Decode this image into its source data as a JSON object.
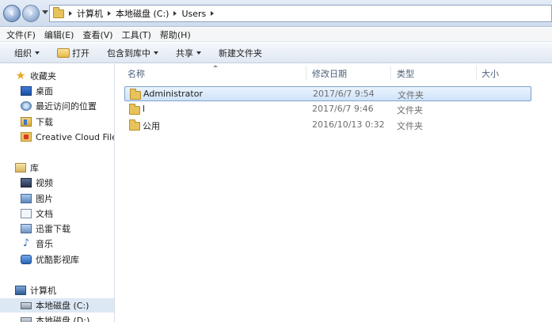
{
  "address": {
    "breadcrumbs": [
      "计算机",
      "本地磁盘 (C:)",
      "Users"
    ]
  },
  "menu": [
    "文件(F)",
    "编辑(E)",
    "查看(V)",
    "工具(T)",
    "帮助(H)"
  ],
  "toolbar": {
    "organize": "组织",
    "open": "打开",
    "include_in_library": "包含到库中",
    "share": "共享",
    "new_folder": "新建文件夹"
  },
  "sidebar": {
    "favorites": {
      "label": "收藏夹",
      "items": [
        "桌面",
        "最近访问的位置",
        "下载",
        "Creative Cloud Files"
      ]
    },
    "libraries": {
      "label": "库",
      "items": [
        "视频",
        "图片",
        "文档",
        "迅雷下载",
        "音乐",
        "优酷影视库"
      ]
    },
    "computer": {
      "label": "计算机",
      "items": [
        "本地磁盘 (C:)",
        "本地磁盘 (D:)"
      ]
    }
  },
  "columns": {
    "name": "名称",
    "modified": "修改日期",
    "type": "类型",
    "size": "大小"
  },
  "files": [
    {
      "name": "Administrator",
      "modified": "2017/6/7 9:54",
      "type": "文件夹",
      "size": ""
    },
    {
      "name": "l",
      "modified": "2017/6/7 9:46",
      "type": "文件夹",
      "size": ""
    },
    {
      "name": "公用",
      "modified": "2016/10/13 0:32",
      "type": "文件夹",
      "size": ""
    }
  ],
  "colors": {
    "selection": "#cfe3fa",
    "selection_border": "#7da2ce",
    "header_text": "#4c607a"
  }
}
